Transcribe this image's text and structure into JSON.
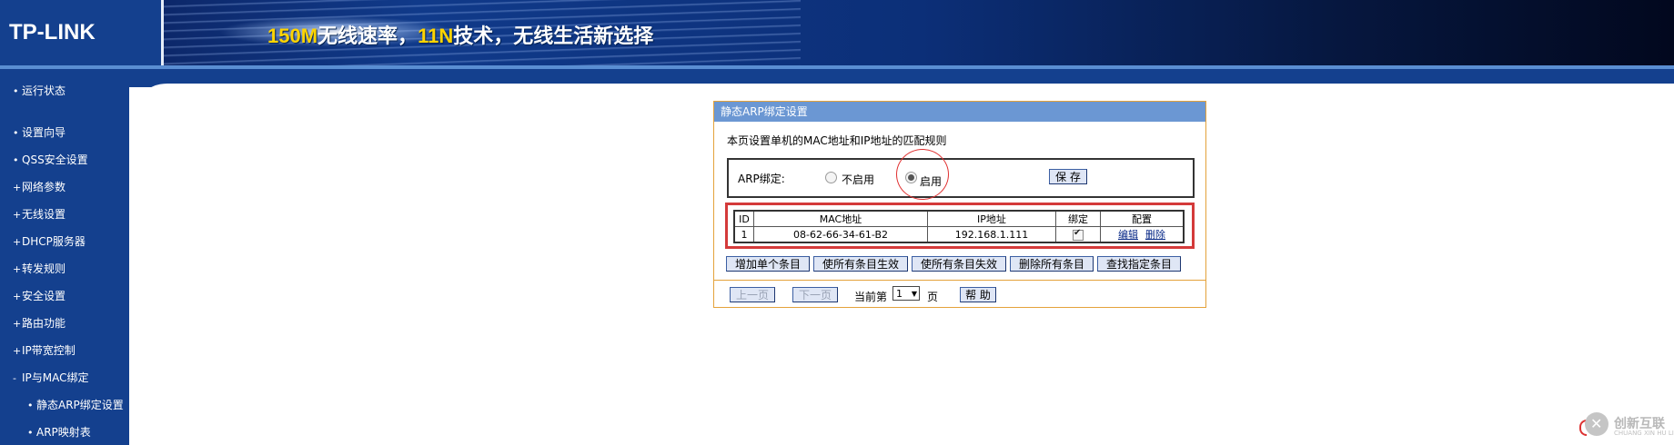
{
  "header": {
    "logo": "TP-LINK",
    "slogan_parts": [
      "150M",
      "无线速率，",
      "11N",
      "技术，无线生活新选择"
    ]
  },
  "sidebar": {
    "items": [
      {
        "mark": "•",
        "label": "运行状态"
      },
      {
        "mark": "•",
        "label": "设置向导"
      },
      {
        "mark": "•",
        "label": "QSS安全设置"
      },
      {
        "mark": "+",
        "label": "网络参数"
      },
      {
        "mark": "+",
        "label": "无线设置"
      },
      {
        "mark": "+",
        "label": "DHCP服务器"
      },
      {
        "mark": "+",
        "label": "转发规则"
      },
      {
        "mark": "+",
        "label": "安全设置"
      },
      {
        "mark": "+",
        "label": "路由功能"
      },
      {
        "mark": "+",
        "label": "IP带宽控制"
      },
      {
        "mark": "-",
        "label": "IP与MAC绑定"
      },
      {
        "mark": "•",
        "label": "静态ARP绑定设置"
      },
      {
        "mark": "•",
        "label": "ARP映射表"
      }
    ]
  },
  "panel": {
    "title": "静态ARP绑定设置",
    "description": "本页设置单机的MAC地址和IP地址的匹配规则",
    "arp_binding": {
      "label": "ARP绑定:",
      "option_disable": "不启用",
      "option_enable": "启用",
      "selected": "启用",
      "save_label": "保 存"
    },
    "table": {
      "headers": [
        "ID",
        "MAC地址",
        "IP地址",
        "绑定",
        "配置"
      ],
      "rows": [
        {
          "id": "1",
          "mac": "08-62-66-34-61-B2",
          "ip": "192.168.1.111",
          "bound": true,
          "edit": "编辑",
          "delete": "删除"
        }
      ]
    },
    "actions": {
      "add": "增加单个条目",
      "enable_all": "使所有条目生效",
      "disable_all": "使所有条目失效",
      "delete_all": "删除所有条目",
      "find": "查找指定条目"
    },
    "pager": {
      "prev": "上一页",
      "next": "下一页",
      "current_prefix": "当前第",
      "page": "1",
      "suffix": "页",
      "help": "帮 助"
    }
  },
  "watermark": {
    "text": "创新互联",
    "sub": "CHUANG XIN HU LIAN"
  },
  "colors": {
    "sidebar_bg": "#14408e",
    "panel_title_bg": "#6b97d3",
    "panel_border": "#e4a23a",
    "highlight_red": "#d43a3a"
  }
}
